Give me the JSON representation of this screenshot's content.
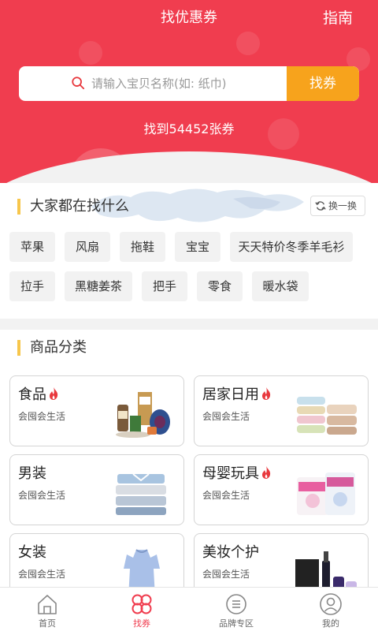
{
  "header": {
    "title": "找优惠券",
    "guide_label": "指南",
    "found_text": "找到54452张券"
  },
  "search": {
    "placeholder": "请输入宝贝名称(如: 纸巾)",
    "button_label": "找券"
  },
  "hot_searches": {
    "title": "大家都在找什么",
    "refresh_label": "换一换",
    "tags": [
      "苹果",
      "风扇",
      "拖鞋",
      "宝宝",
      "天天特价冬季羊毛衫",
      "拉手",
      "黑糖姜茶",
      "把手",
      "零食",
      "暖水袋"
    ]
  },
  "categories": {
    "title": "商品分类",
    "items": [
      {
        "title": "食品",
        "subtitle": "会囤会生活",
        "hot": true,
        "image": "food-products"
      },
      {
        "title": "居家日用",
        "subtitle": "会囤会生活",
        "hot": true,
        "image": "folded-towels"
      },
      {
        "title": "男装",
        "subtitle": "会囤会生活",
        "hot": false,
        "image": "folded-shirts"
      },
      {
        "title": "母婴玩具",
        "subtitle": "会囤会生活",
        "hot": true,
        "image": "diaper-packs"
      },
      {
        "title": "女装",
        "subtitle": "会囤会生活",
        "hot": false,
        "image": "blue-dress"
      },
      {
        "title": "美妆个护",
        "subtitle": "会囤会生活",
        "hot": false,
        "image": "cosmetics"
      }
    ]
  },
  "bottom_nav": {
    "items": [
      {
        "label": "首页",
        "icon": "home-icon",
        "active": false
      },
      {
        "label": "找券",
        "icon": "coupon-clover-icon",
        "active": true
      },
      {
        "label": "品牌专区",
        "icon": "brand-list-icon",
        "active": false
      },
      {
        "label": "我的",
        "icon": "user-icon",
        "active": false
      }
    ]
  },
  "colors": {
    "brand_red": "#f03d4f",
    "accent_orange": "#f7a31c",
    "section_marker": "#f7c64b",
    "hot_flame": "#e8383d"
  }
}
